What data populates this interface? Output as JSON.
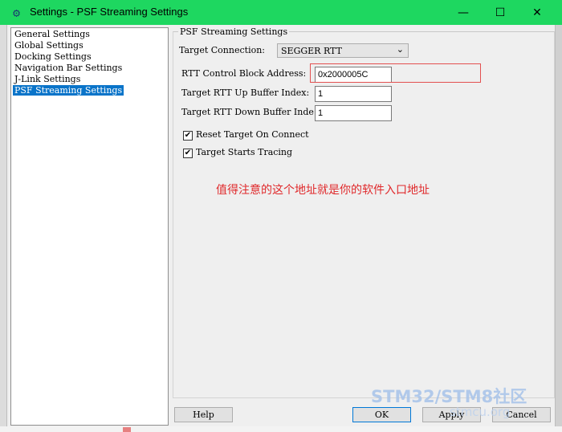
{
  "window": {
    "title": "Settings - PSF Streaming Settings",
    "minimize_glyph": "—",
    "maximize_glyph": "☐",
    "close_glyph": "✕",
    "app_icon": "gear-icon"
  },
  "tree": {
    "items": [
      {
        "label": "General Settings",
        "selected": false
      },
      {
        "label": "Global Settings",
        "selected": false
      },
      {
        "label": "Docking Settings",
        "selected": false
      },
      {
        "label": "Navigation Bar Settings",
        "selected": false
      },
      {
        "label": "J-Link Settings",
        "selected": false
      },
      {
        "label": "PSF Streaming Settings",
        "selected": true
      }
    ]
  },
  "panel": {
    "group_title": "PSF Streaming Settings",
    "target_connection": {
      "label": "Target Connection:",
      "value": "SEGGER RTT"
    },
    "rtt_block": {
      "label": "RTT Control Block Address:",
      "value": "0x2000005C"
    },
    "up_buffer": {
      "label": "Target RTT Up Buffer Index:",
      "value": "1"
    },
    "down_buffer": {
      "label": "Target RTT Down Buffer Index:",
      "value": "1"
    },
    "reset_target": {
      "label": "Reset Target On Connect",
      "checked": true
    },
    "starts_tracing": {
      "label": "Target Starts Tracing",
      "checked": true
    },
    "annotation": "值得注意的这个地址就是你的软件入口地址"
  },
  "buttons": {
    "help": "Help",
    "ok": "OK",
    "apply": "Apply",
    "cancel": "Cancel"
  },
  "watermark": {
    "title": "STM32/STM8社区",
    "sub": "stmcu.org"
  },
  "colors": {
    "titlebar": "#1ed760",
    "selection": "#0a74c9",
    "annotation": "#e0292b",
    "highlight_border": "#e35050"
  }
}
